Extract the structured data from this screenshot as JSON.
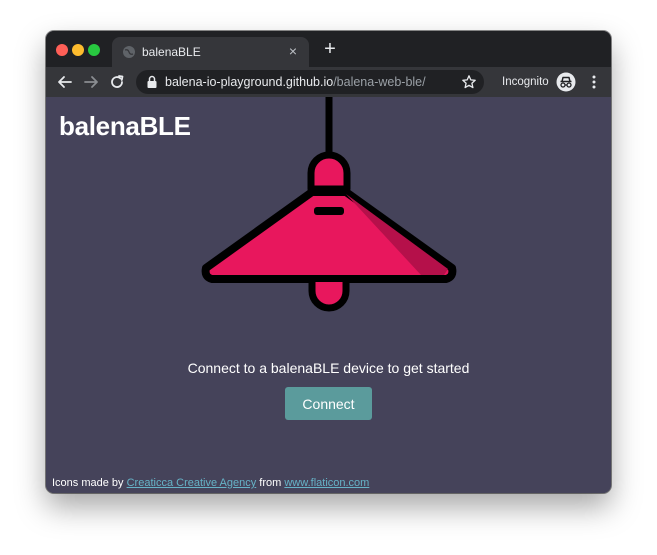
{
  "browser": {
    "tab": {
      "title": "balenaBLE",
      "close_glyph": "×"
    },
    "new_tab_glyph": "+",
    "address": {
      "host": "balena-io-playground.github.io",
      "path": "/balena-web-ble/"
    },
    "incognito_label": "Incognito",
    "icons": [
      "globe-icon",
      "close-icon",
      "plus-icon",
      "back-arrow-icon",
      "forward-arrow-icon",
      "reload-icon",
      "lock-icon",
      "star-icon",
      "incognito-icon",
      "kebab-menu-icon"
    ]
  },
  "page": {
    "title": "balenaBLE",
    "illustration": "pendant-lamp-icon",
    "subtitle": "Connect to a balenaBLE device to get started",
    "connect_label": "Connect",
    "credits": {
      "prefix": "Icons made by",
      "author": "Creaticca Creative Agency",
      "middle": "from",
      "site": "www.flaticon.com"
    }
  },
  "colors": {
    "page_background": "#45435a",
    "button": "#5b9b9c",
    "lamp_shade": "#e8175d",
    "link": "#66b3c7"
  }
}
